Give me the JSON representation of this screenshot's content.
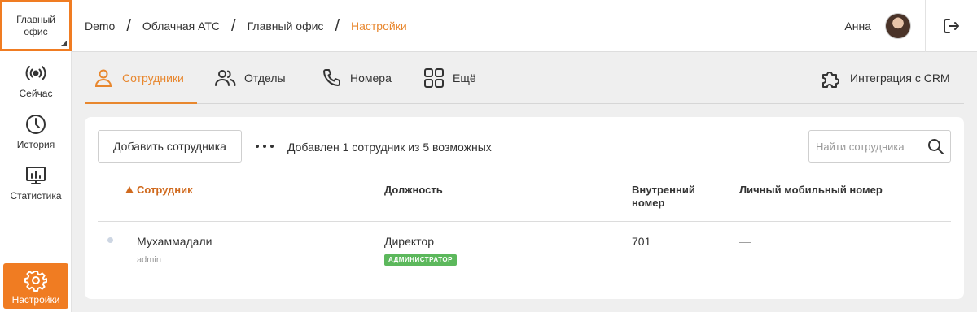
{
  "sidebar": {
    "office_switch": "Главный офис",
    "items": [
      {
        "label": "Сейчас",
        "icon": "broadcast-icon"
      },
      {
        "label": "История",
        "icon": "clock-icon"
      },
      {
        "label": "Статистика",
        "icon": "chart-monitor-icon"
      },
      {
        "label": "Настройки",
        "icon": "gear-icon",
        "active": true
      }
    ]
  },
  "header": {
    "breadcrumbs": [
      "Demo",
      "Облачная АТС",
      "Главный офис",
      "Настройки"
    ],
    "separator": "/",
    "user_name": "Анна"
  },
  "tabs": [
    {
      "label": "Сотрудники",
      "icon": "person-icon",
      "active": true
    },
    {
      "label": "Отделы",
      "icon": "people-icon"
    },
    {
      "label": "Номера",
      "icon": "phone-icon"
    },
    {
      "label": "Ещё",
      "icon": "grid-icon"
    },
    {
      "label": "Интеграция с CRM",
      "icon": "puzzle-icon"
    }
  ],
  "toolbar": {
    "add_button": "Добавить сотрудника",
    "count_text": "Добавлен 1 сотрудник из 5 возможных",
    "search_placeholder": "Найти сотрудника"
  },
  "table": {
    "headers": [
      "Сотрудник",
      "Должность",
      "Внутренний номер",
      "Личный мобильный номер"
    ],
    "rows": [
      {
        "name": "Мухаммадали",
        "login": "admin",
        "position": "Директор",
        "role_badge": "АДМИНИСТРАТОР",
        "extension": "701",
        "mobile": "—"
      }
    ]
  },
  "colors": {
    "accent": "#e8872e",
    "active_nav": "#f07c22",
    "badge": "#5cb85c"
  }
}
